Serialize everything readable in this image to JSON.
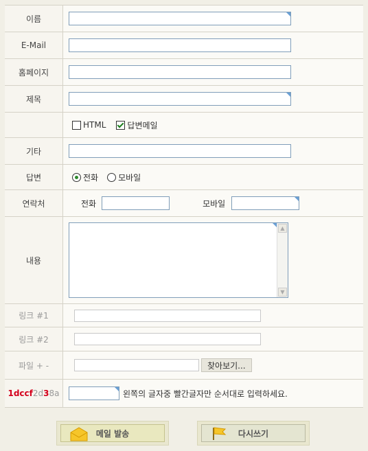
{
  "labels": {
    "name": "이름",
    "email": "E-Mail",
    "homepage": "홈페이지",
    "subject": "제목",
    "etc": "기타",
    "reply": "답변",
    "contact": "연락처",
    "content": "내용",
    "link1": "링크 #1",
    "link2": "링크 #2",
    "file": "파일 + -"
  },
  "options": {
    "html": "HTML",
    "reply_mail": "답변메일",
    "phone": "전화",
    "mobile": "모바일",
    "contact_phone": "전화",
    "contact_mobile": "모바일"
  },
  "file": {
    "browse_label": "찾아보기..."
  },
  "captcha": {
    "parts": [
      {
        "text": "1dccf",
        "highlight": true
      },
      {
        "text": "2d",
        "highlight": false
      },
      {
        "text": "3",
        "highlight": true
      },
      {
        "text": "8a",
        "highlight": false
      }
    ],
    "instruction": "왼쪽의 글자중 빨간글자만 순서대로 입력하세요."
  },
  "buttons": {
    "send": "메일 발송",
    "rewrite": "다시쓰기"
  }
}
